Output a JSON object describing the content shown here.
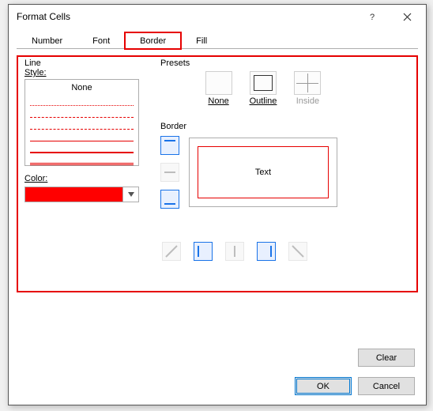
{
  "window": {
    "title": "Format Cells"
  },
  "tabs": {
    "items": [
      {
        "label": "Number"
      },
      {
        "label": "Font"
      },
      {
        "label": "Border"
      },
      {
        "label": "Fill"
      }
    ],
    "active": "Border"
  },
  "line_section": {
    "title": "Line",
    "style_label": "Style:",
    "none_label": "None",
    "color_label": "Color:",
    "selected_color": "#ff0000"
  },
  "presets": {
    "title": "Presets",
    "none": "None",
    "outline": "Outline",
    "inside": "Inside"
  },
  "border_section": {
    "title": "Border",
    "preview_text": "Text"
  },
  "buttons": {
    "clear": "Clear",
    "ok": "OK",
    "cancel": "Cancel"
  }
}
